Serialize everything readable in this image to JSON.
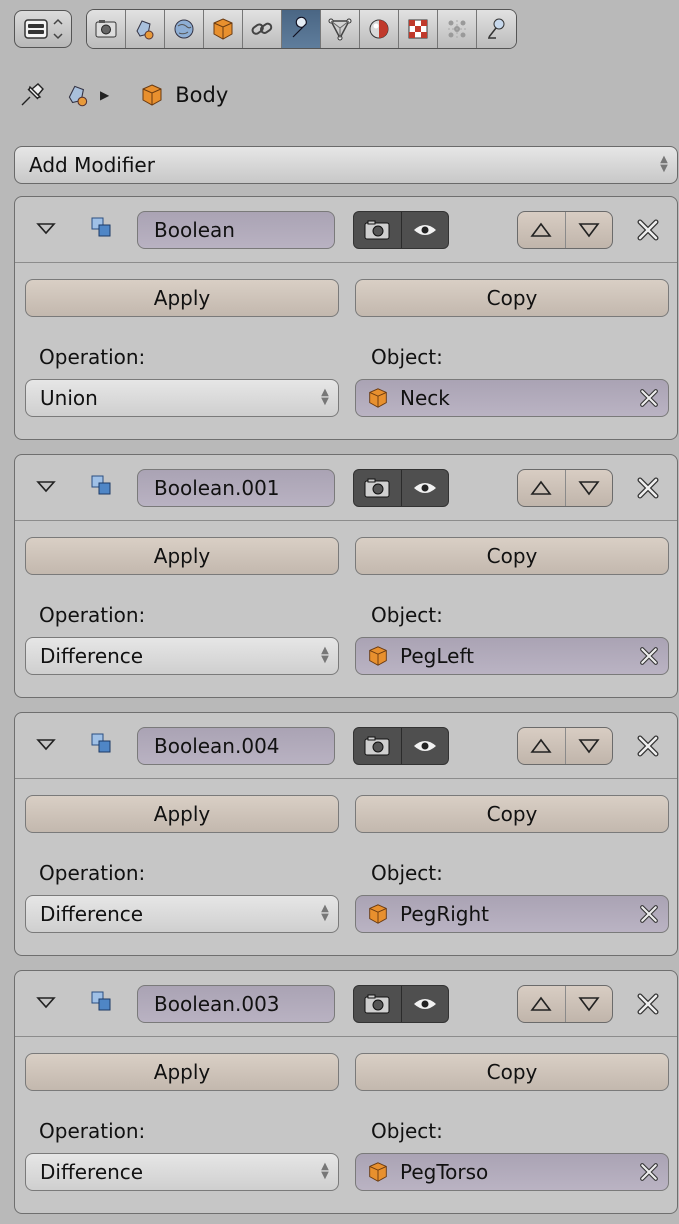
{
  "toolbar": {
    "editor_icon": "properties-editor-icon",
    "tabs": [
      {
        "icon": "render-icon"
      },
      {
        "icon": "scene-icon"
      },
      {
        "icon": "world-icon"
      },
      {
        "icon": "object-icon"
      },
      {
        "icon": "constraints-icon"
      },
      {
        "icon": "modifiers-wrench-icon",
        "active": true
      },
      {
        "icon": "data-mesh-icon"
      },
      {
        "icon": "material-icon"
      },
      {
        "icon": "texture-icon"
      },
      {
        "icon": "particles-icon"
      },
      {
        "icon": "physics-icon"
      }
    ]
  },
  "breadcrumb": {
    "object_label": "Body"
  },
  "add_modifier": {
    "label": "Add Modifier"
  },
  "modifiers": [
    {
      "name": "Boolean",
      "apply_label": "Apply",
      "copy_label": "Copy",
      "operation_label": "Operation:",
      "operation": "Union",
      "object_label": "Object:",
      "object": "Neck"
    },
    {
      "name": "Boolean.001",
      "apply_label": "Apply",
      "copy_label": "Copy",
      "operation_label": "Operation:",
      "operation": "Difference",
      "object_label": "Object:",
      "object": "PegLeft"
    },
    {
      "name": "Boolean.004",
      "apply_label": "Apply",
      "copy_label": "Copy",
      "operation_label": "Operation:",
      "operation": "Difference",
      "object_label": "Object:",
      "object": "PegRight"
    },
    {
      "name": "Boolean.003",
      "apply_label": "Apply",
      "copy_label": "Copy",
      "operation_label": "Operation:",
      "operation": "Difference",
      "object_label": "Object:",
      "object": "PegTorso"
    }
  ],
  "colors": {
    "background": "#b9b9b9",
    "panel": "#c6c6c6",
    "active_tab": "#5a7797",
    "name_field": "#b1aabb",
    "button": "#cdc2b8",
    "object_orange": "#e8902e"
  }
}
